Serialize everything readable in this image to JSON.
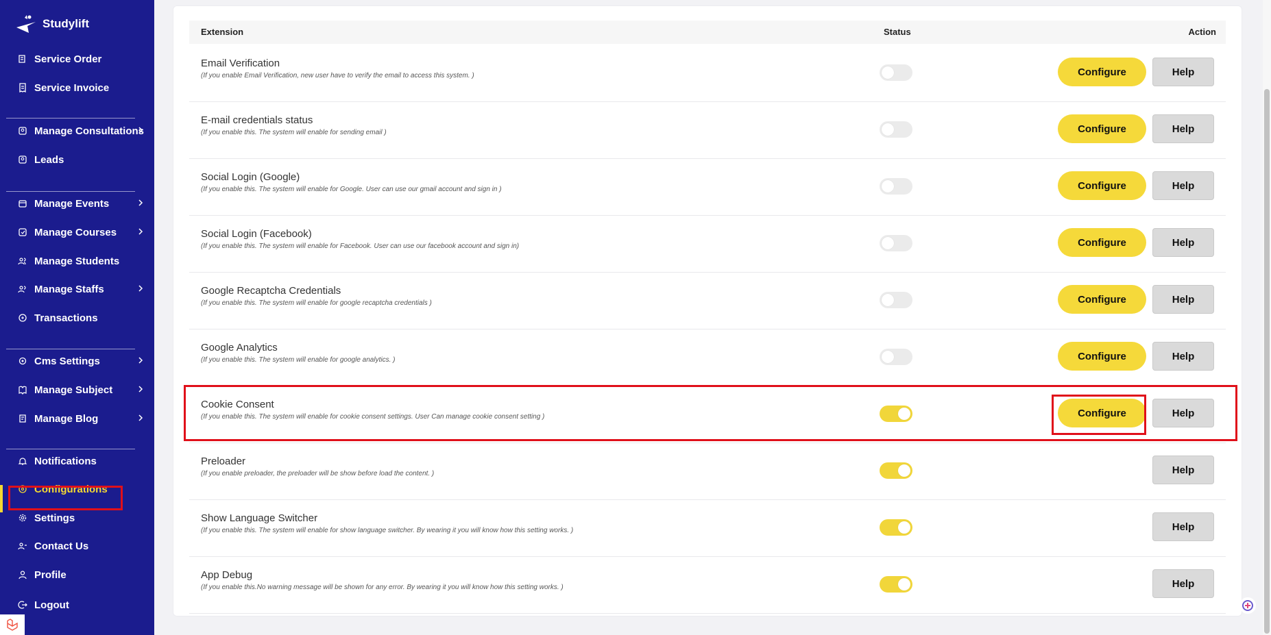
{
  "brand": {
    "name": "Studylift"
  },
  "sidebar": {
    "items": [
      {
        "label": "Service Order",
        "icon": "service-order-icon",
        "has_chevron": false
      },
      {
        "label": "Service Invoice",
        "icon": "invoice-icon",
        "has_chevron": false
      },
      {
        "label": "Manage Consultations",
        "icon": "consultation-icon",
        "has_chevron": true
      },
      {
        "label": "Leads",
        "icon": "leads-icon",
        "has_chevron": false
      },
      {
        "label": "Manage Events",
        "icon": "events-icon",
        "has_chevron": true
      },
      {
        "label": "Manage Courses",
        "icon": "courses-icon",
        "has_chevron": true
      },
      {
        "label": "Manage Students",
        "icon": "students-icon",
        "has_chevron": false
      },
      {
        "label": "Manage Staffs",
        "icon": "staffs-icon",
        "has_chevron": true
      },
      {
        "label": "Transactions",
        "icon": "transactions-icon",
        "has_chevron": false
      },
      {
        "label": "Cms Settings",
        "icon": "cms-settings-icon",
        "has_chevron": true
      },
      {
        "label": "Manage Subject",
        "icon": "subject-icon",
        "has_chevron": true
      },
      {
        "label": "Manage Blog",
        "icon": "blog-icon",
        "has_chevron": true
      },
      {
        "label": "Notifications",
        "icon": "bell-icon",
        "has_chevron": false
      },
      {
        "label": "Configurations",
        "icon": "configurations-icon",
        "has_chevron": false,
        "active": true
      },
      {
        "label": "Settings",
        "icon": "gear-icon",
        "has_chevron": false
      },
      {
        "label": "Contact Us",
        "icon": "contact-icon",
        "has_chevron": false
      },
      {
        "label": "Profile",
        "icon": "user-icon",
        "has_chevron": false
      },
      {
        "label": "Logout",
        "icon": "logout-icon",
        "has_chevron": false
      }
    ]
  },
  "table": {
    "headers": {
      "extension": "Extension",
      "status": "Status",
      "action": "Action"
    },
    "rows": [
      {
        "title": "Email Verification",
        "desc": "(If you enable Email Verification, new user have to verify the email to access this system. )",
        "enabled": false,
        "configurable": true
      },
      {
        "title": "E-mail credentials status",
        "desc": "(If you enable this. The system will enable for sending email )",
        "enabled": false,
        "configurable": true
      },
      {
        "title": "Social Login (Google)",
        "desc": "(If you enable this. The system will enable for Google. User can use our gmail account and sign in )",
        "enabled": false,
        "configurable": true
      },
      {
        "title": "Social Login (Facebook)",
        "desc": "(If you enable this. The system will enable for Facebook. User can use our facebook account and sign in)",
        "enabled": false,
        "configurable": true
      },
      {
        "title": "Google Recaptcha Credentials",
        "desc": "(If you enable this. The system will enable for google recaptcha credentials )",
        "enabled": false,
        "configurable": true
      },
      {
        "title": "Google Analytics",
        "desc": "(If you enable this. The system will enable for google analytics. )",
        "enabled": false,
        "configurable": true
      },
      {
        "title": "Cookie Consent",
        "desc": "(If you enable this. The system will enable for cookie consent settings. User Can manage cookie consent setting )",
        "enabled": true,
        "configurable": true
      },
      {
        "title": "Preloader",
        "desc": "(If you enable preloader, the preloader will be show before load the content. )",
        "enabled": true,
        "configurable": false
      },
      {
        "title": "Show Language Switcher",
        "desc": "(If you enable this. The system will enable for show language switcher. By wearing it you will know how this setting works. )",
        "enabled": true,
        "configurable": false
      },
      {
        "title": "App Debug",
        "desc": "(If you enable this.No warning message will be shown for any error. By wearing it you will know how this setting works. )",
        "enabled": true,
        "configurable": false
      }
    ],
    "configure_label": "Configure",
    "help_label": "Help"
  },
  "colors": {
    "sidebar_bg": "#1b1c8e",
    "accent_yellow": "#f5d93a",
    "highlight_red": "#e0101a"
  }
}
